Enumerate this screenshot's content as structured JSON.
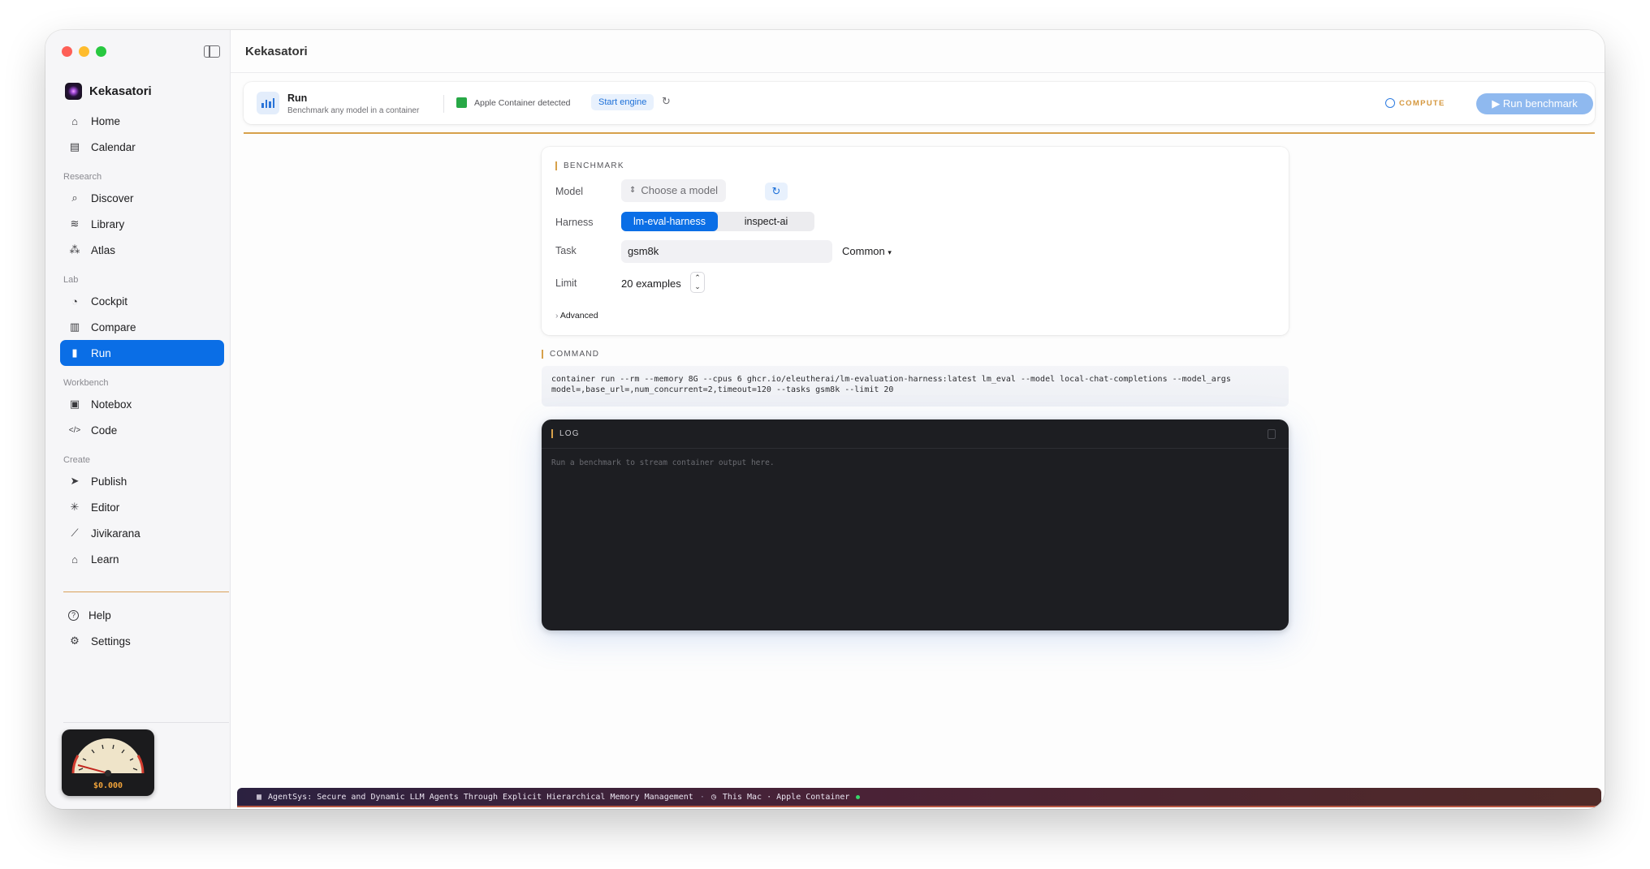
{
  "app": {
    "name": "Kekasatori",
    "window_title": "Kekasatori"
  },
  "sidebar": {
    "top_items": [
      {
        "label": "Home",
        "icon": "house-icon"
      },
      {
        "label": "Calendar",
        "icon": "calendar-icon"
      }
    ],
    "sections": [
      {
        "title": "Research",
        "items": [
          {
            "label": "Discover",
            "icon": "magnifier-icon"
          },
          {
            "label": "Library",
            "icon": "layers-icon"
          },
          {
            "label": "Atlas",
            "icon": "graph-icon"
          }
        ]
      },
      {
        "title": "Lab",
        "items": [
          {
            "label": "Cockpit",
            "icon": "gauge-icon"
          },
          {
            "label": "Compare",
            "icon": "columns-icon"
          },
          {
            "label": "Run",
            "icon": "chart-bars-icon",
            "active": true
          }
        ]
      },
      {
        "title": "Workbench",
        "items": [
          {
            "label": "Notebox",
            "icon": "notebook-icon"
          },
          {
            "label": "Code",
            "icon": "code-icon"
          }
        ]
      },
      {
        "title": "Create",
        "items": [
          {
            "label": "Publish",
            "icon": "paper-plane-icon"
          },
          {
            "label": "Editor",
            "icon": "sparkle-icon"
          },
          {
            "label": "Jivikarana",
            "icon": "wand-icon"
          },
          {
            "label": "Learn",
            "icon": "graduation-cap-icon"
          }
        ]
      }
    ],
    "bottom_items": [
      {
        "label": "Help",
        "icon": "question-circle-icon"
      },
      {
        "label": "Settings",
        "icon": "gear-icon"
      }
    ],
    "cost_meter": {
      "value": "$0.000",
      "needle_fraction": 0.0
    }
  },
  "toolbar": {
    "title": "Run",
    "subtitle": "Benchmark any model in a container",
    "engine_status": "Apple Container detected",
    "start_engine": "Start engine",
    "compute_label": "COMPUTE",
    "run_button": "Run benchmark"
  },
  "benchmark": {
    "section_label": "BENCHMARK",
    "model_label": "Model",
    "model_placeholder": "Choose a model",
    "harness_label": "Harness",
    "harness_options": [
      "lm-eval-harness",
      "inspect-ai"
    ],
    "harness_selected": "lm-eval-harness",
    "task_label": "Task",
    "task_value": "gsm8k",
    "task_preset": "Common",
    "limit_label": "Limit",
    "limit_value": "20 examples",
    "advanced_label": "Advanced"
  },
  "command": {
    "section_label": "COMMAND",
    "line1": "container run --rm --memory 8G --cpus 6 ghcr.io/eleutherai/lm-evaluation-harness:latest lm_eval --model local-chat-completions --model_args",
    "line2": "model=,base_url=,num_concurrent=2,timeout=120 --tasks gsm8k --limit 20"
  },
  "log": {
    "section_label": "LOG",
    "placeholder": "Run a benchmark to stream container output here."
  },
  "statusbar": {
    "paper": "AgentSys: Secure and Dynamic LLM Agents Through Explicit Hierarchical Memory Management",
    "separator": "·",
    "machine": "This Mac · Apple Container"
  },
  "colors": {
    "accent": "#0a6ee6",
    "rule": "#d7a14b",
    "log_bg": "#1d1e22"
  }
}
